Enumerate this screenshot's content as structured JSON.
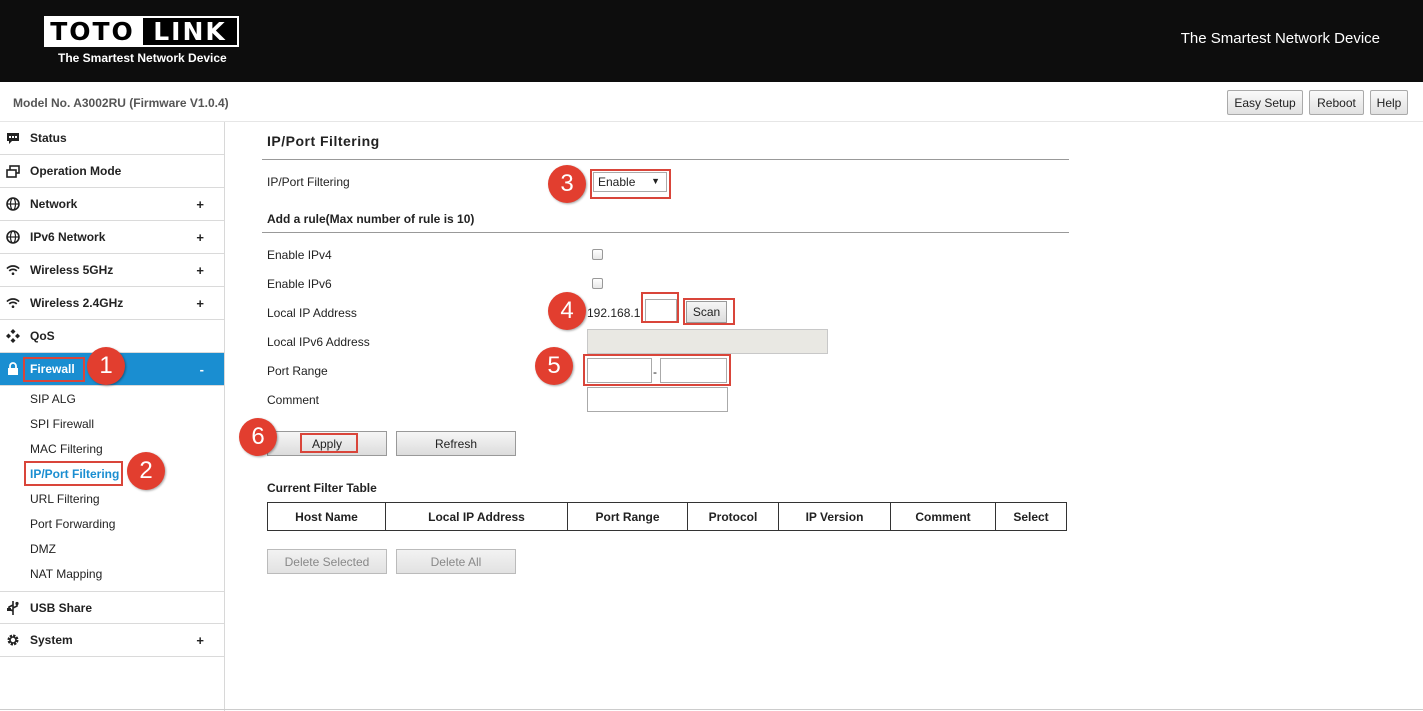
{
  "header": {
    "logo_left": "TOTO",
    "logo_right": "LINK",
    "logo_tagline": "The Smartest Network Device",
    "tagline": "The Smartest Network Device"
  },
  "modelbar": {
    "model": "Model No. A3002RU (Firmware V1.0.4)",
    "easy_setup": "Easy Setup",
    "reboot": "Reboot",
    "help": "Help"
  },
  "sidebar": {
    "items": [
      {
        "label": "Status",
        "icon": "chat-icon",
        "expand": ""
      },
      {
        "label": "Operation Mode",
        "icon": "window-icon",
        "expand": ""
      },
      {
        "label": "Network",
        "icon": "globe-icon",
        "expand": "+"
      },
      {
        "label": "IPv6 Network",
        "icon": "globe-icon",
        "expand": "+"
      },
      {
        "label": "Wireless 5GHz",
        "icon": "wifi-icon",
        "expand": "+"
      },
      {
        "label": "Wireless 2.4GHz",
        "icon": "wifi-icon",
        "expand": "+"
      },
      {
        "label": "QoS",
        "icon": "qos-icon",
        "expand": ""
      },
      {
        "label": "Firewall",
        "icon": "lock-icon",
        "expand": "-"
      },
      {
        "label": "USB Share",
        "icon": "usb-icon",
        "expand": ""
      },
      {
        "label": "System",
        "icon": "gear-icon",
        "expand": "+"
      }
    ],
    "firewall_sub": [
      "SIP ALG",
      "SPI Firewall",
      "MAC Filtering",
      "IP/Port Filtering",
      "URL Filtering",
      "Port Forwarding",
      "DMZ",
      "NAT Mapping"
    ]
  },
  "main": {
    "title": "IP/Port Filtering",
    "filtering_label": "IP/Port Filtering",
    "filtering_value": "Enable",
    "add_rule_heading": "Add a rule(Max number of rule is 10)",
    "enable_ipv4": "Enable IPv4",
    "enable_ipv6": "Enable IPv6",
    "local_ip": "Local IP Address",
    "local_ip_prefix": "192.168.1.",
    "scan": "Scan",
    "local_ipv6": "Local IPv6 Address",
    "port_range": "Port Range",
    "port_dash": "-",
    "comment": "Comment",
    "apply": "Apply",
    "refresh": "Refresh",
    "table_heading": "Current Filter Table",
    "columns": [
      "Host Name",
      "Local IP Address",
      "Port Range",
      "Protocol",
      "IP Version",
      "Comment",
      "Select"
    ],
    "delete_selected": "Delete Selected",
    "delete_all": "Delete All"
  },
  "annotations": [
    "1",
    "2",
    "3",
    "4",
    "5",
    "6"
  ],
  "colors": {
    "accent": "#1a8ed1",
    "annotation": "#e23e2f",
    "header_bg": "#0d0d0d"
  }
}
